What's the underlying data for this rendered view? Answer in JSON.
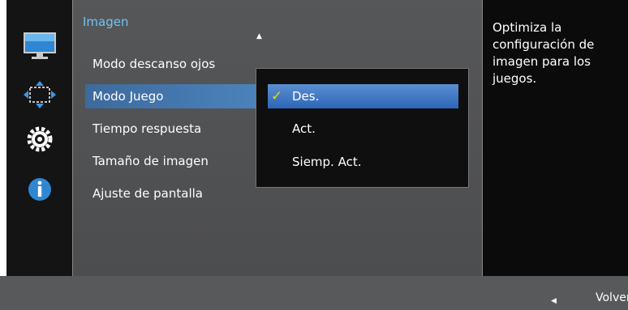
{
  "colors": {
    "title_accent": "#6fc3f5",
    "selected_item": "#4c84be",
    "check_mark": "#f5d300",
    "panel_bg": "#525355",
    "bottom_bar": "#58595b"
  },
  "sidebar": {
    "icons": [
      "monitor-picture-icon",
      "screen-size-arrows-icon",
      "gear-settings-icon",
      "info-icon"
    ]
  },
  "menu": {
    "title": "Imagen",
    "scroll_up_glyph": "▲",
    "items": [
      {
        "label": "Modo descanso ojos"
      },
      {
        "label": "Modo Juego"
      },
      {
        "label": "Tiempo respuesta"
      },
      {
        "label": "Tamaño de imagen"
      },
      {
        "label": "Ajuste de pantalla"
      }
    ]
  },
  "dropdown": {
    "check_glyph": "✓",
    "options": [
      {
        "label": "Des."
      },
      {
        "label": "Act."
      },
      {
        "label": "Siemp. Act."
      }
    ]
  },
  "help": {
    "text": "Optimiza la configuración de imagen para los juegos."
  },
  "footer": {
    "back_glyph": "◀",
    "back_label": "Volver"
  }
}
